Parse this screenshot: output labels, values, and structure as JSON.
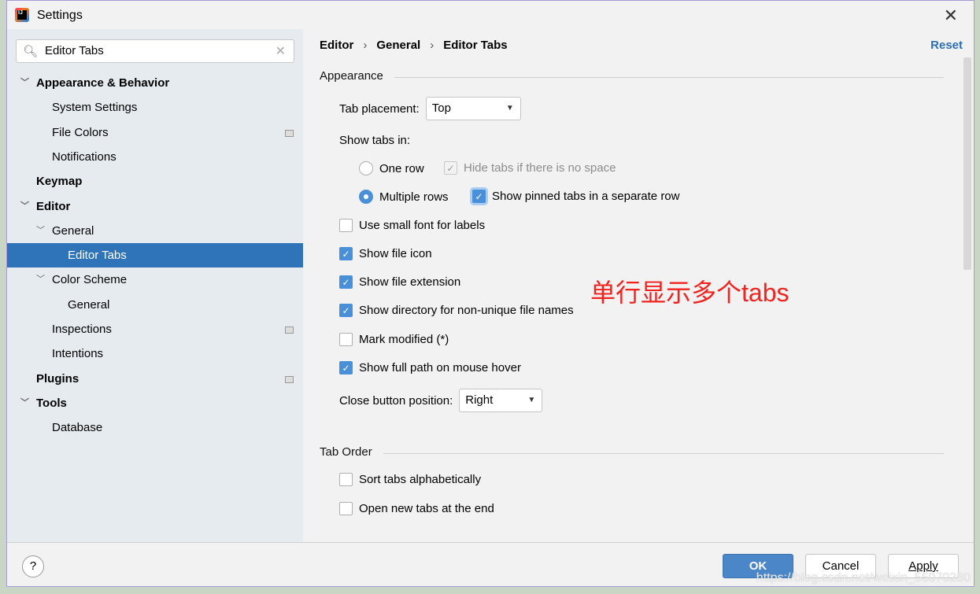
{
  "window": {
    "title": "Settings"
  },
  "search": {
    "value": "Editor Tabs"
  },
  "tree": [
    {
      "label": "Appearance & Behavior",
      "level": 0,
      "bold": true,
      "chevron": true
    },
    {
      "label": "System Settings",
      "level": 1
    },
    {
      "label": "File Colors",
      "level": 1,
      "project": true
    },
    {
      "label": "Notifications",
      "level": 1
    },
    {
      "label": "Keymap",
      "level": 0,
      "bold": true
    },
    {
      "label": "Editor",
      "level": 0,
      "bold": true,
      "chevron": true
    },
    {
      "label": "General",
      "level": 1,
      "chevron": true
    },
    {
      "label": "Editor Tabs",
      "level": 2,
      "selected": true
    },
    {
      "label": "Color Scheme",
      "level": 1,
      "chevron": true
    },
    {
      "label": "General",
      "level": 2
    },
    {
      "label": "Inspections",
      "level": 1,
      "project": true
    },
    {
      "label": "Intentions",
      "level": 1
    },
    {
      "label": "Plugins",
      "level": 0,
      "bold": true,
      "project": true
    },
    {
      "label": "Tools",
      "level": 0,
      "bold": true,
      "chevron": true
    },
    {
      "label": "Database",
      "level": 1
    }
  ],
  "breadcrumb": [
    "Editor",
    "General",
    "Editor Tabs"
  ],
  "reset": "Reset",
  "appearance": {
    "title": "Appearance",
    "tab_placement_label": "Tab placement:",
    "tab_placement": "Top",
    "show_tabs_in": "Show tabs in:",
    "one_row": "One row",
    "hide_tabs": "Hide tabs if there is no space",
    "multiple_rows": "Multiple rows",
    "show_pinned": "Show pinned tabs in a separate row",
    "small_font": "Use small font for labels",
    "file_icon": "Show file icon",
    "file_ext": "Show file extension",
    "directory": "Show directory for non-unique file names",
    "modified": "Mark modified (*)",
    "full_path": "Show full path on mouse hover",
    "close_pos_label": "Close button position:",
    "close_pos": "Right"
  },
  "tab_order": {
    "title": "Tab Order",
    "sort": "Sort tabs alphabetically",
    "open_end": "Open new tabs at the end"
  },
  "annotation": "单行显示多个tabs",
  "footer": {
    "help": "?",
    "ok": "OK",
    "cancel": "Cancel",
    "apply": "Apply"
  },
  "watermark": "https://blog.csdn.net/weixin_55070280",
  "colors": {
    "accent": "#4a90d9",
    "selection": "#2f73b9",
    "annotation": "#f0231e"
  }
}
